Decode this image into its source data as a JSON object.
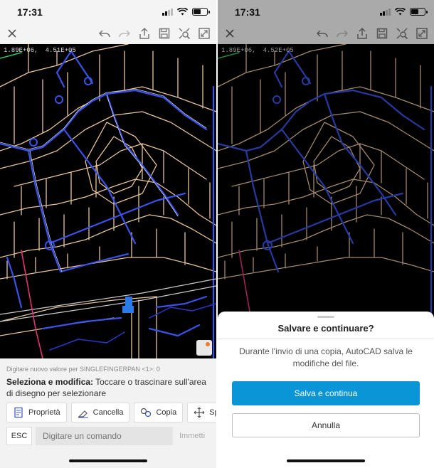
{
  "status": {
    "time": "17:31"
  },
  "drawing": {
    "coord_x": "1.89E+06,",
    "coord_y_left": "4.51E+05",
    "coord_y_right": "4.52E+05"
  },
  "icons": [
    "close-icon",
    "undo-icon",
    "redo-icon",
    "share-icon",
    "save-icon",
    "zoom-extents-icon",
    "fullscreen-icon",
    "layers-icon",
    "location-arrow-icon"
  ],
  "command_panel": {
    "hint": "Digitare nuovo valore per SINGLEFINGERPAN <1>: 0",
    "title": "Seleziona e modifica:",
    "description": "Toccare o trascinare sull'area di disegno per selezionare",
    "actions": [
      {
        "label": "Proprietà",
        "icon": "properties-icon"
      },
      {
        "label": "Cancella",
        "icon": "erase-icon"
      },
      {
        "label": "Copia",
        "icon": "copy-icon"
      },
      {
        "label": "Sp",
        "icon": "move-icon"
      }
    ],
    "esc_label": "ESC",
    "input_placeholder": "Digitare un comando",
    "enter_label": "Immetti"
  },
  "dialog": {
    "title": "Salvare e continuare?",
    "message": "Durante l'invio di una copia, AutoCAD salva le modifiche del file.",
    "primary_label": "Salva e continua",
    "secondary_label": "Annulla"
  },
  "colors": {
    "primary": "#0a96d6",
    "road_blue": "#3a52e6",
    "lot_lines": "#e7c49a",
    "accent_orange": "#f07a2a"
  }
}
